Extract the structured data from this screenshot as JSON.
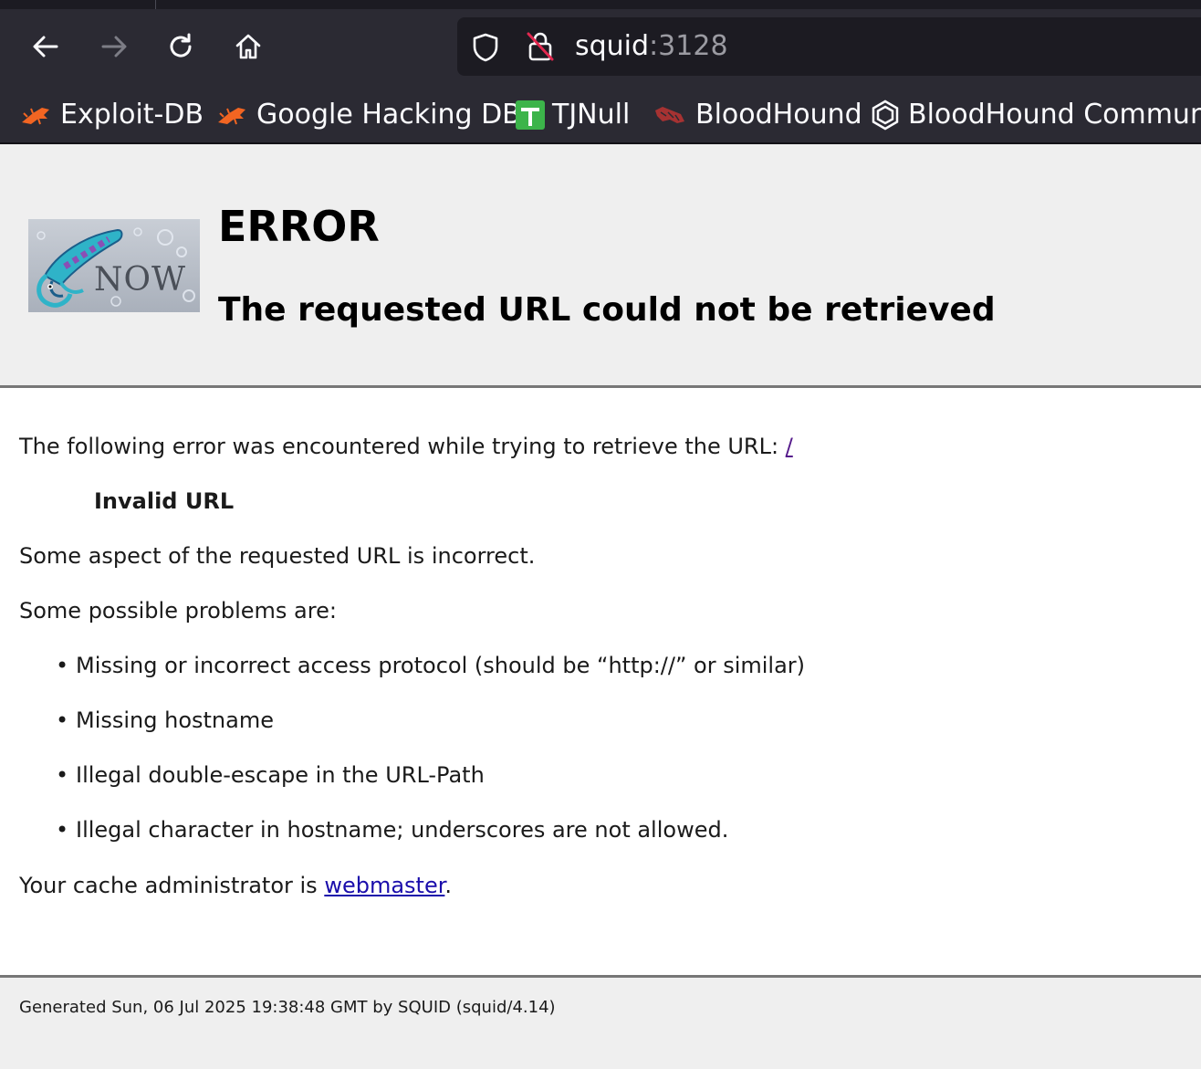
{
  "browser": {
    "address": {
      "host": "squid",
      "port": ":3128"
    },
    "nav_icons": [
      "back-arrow-icon",
      "forward-arrow-icon",
      "reload-icon",
      "home-icon"
    ],
    "bookmarks": [
      {
        "label": "Exploit-DB",
        "icon": "exploit-db-icon"
      },
      {
        "label": "Google Hacking DB",
        "icon": "exploit-db-icon"
      },
      {
        "label": "TJNull",
        "icon": "tjnull-icon"
      },
      {
        "label": "BloodHound",
        "icon": "bloodhound-icon"
      },
      {
        "label": "BloodHound Commun...",
        "icon": "hexagon-icon"
      }
    ]
  },
  "page": {
    "title": "ERROR",
    "subtitle": "The requested URL could not be retrieved",
    "intro": "The following error was encountered while trying to retrieve the URL: ",
    "url_link": "/",
    "error_name": "Invalid URL",
    "description": "Some aspect of the requested URL is incorrect.",
    "problems_heading": "Some possible problems are:",
    "problems": [
      "Missing or incorrect access protocol (should be “http://” or similar)",
      "Missing hostname",
      "Illegal double-escape in the URL-Path",
      "Illegal character in hostname; underscores are not allowed."
    ],
    "admin_prefix": "Your cache administrator is ",
    "admin_link": "webmaster",
    "admin_suffix": ".",
    "footer": "Generated Sun, 06 Jul 2025 19:38:48 GMT by SQUID (squid/4.14)"
  },
  "colors": {
    "chrome_bg": "#2b2a33",
    "url_bg": "#1c1b22",
    "header_bg": "#efefef",
    "link": "#1a0dab",
    "visited_link": "#551a8b",
    "tjnull_green": "#3cb44a",
    "exploit_orange": "#f26522"
  }
}
